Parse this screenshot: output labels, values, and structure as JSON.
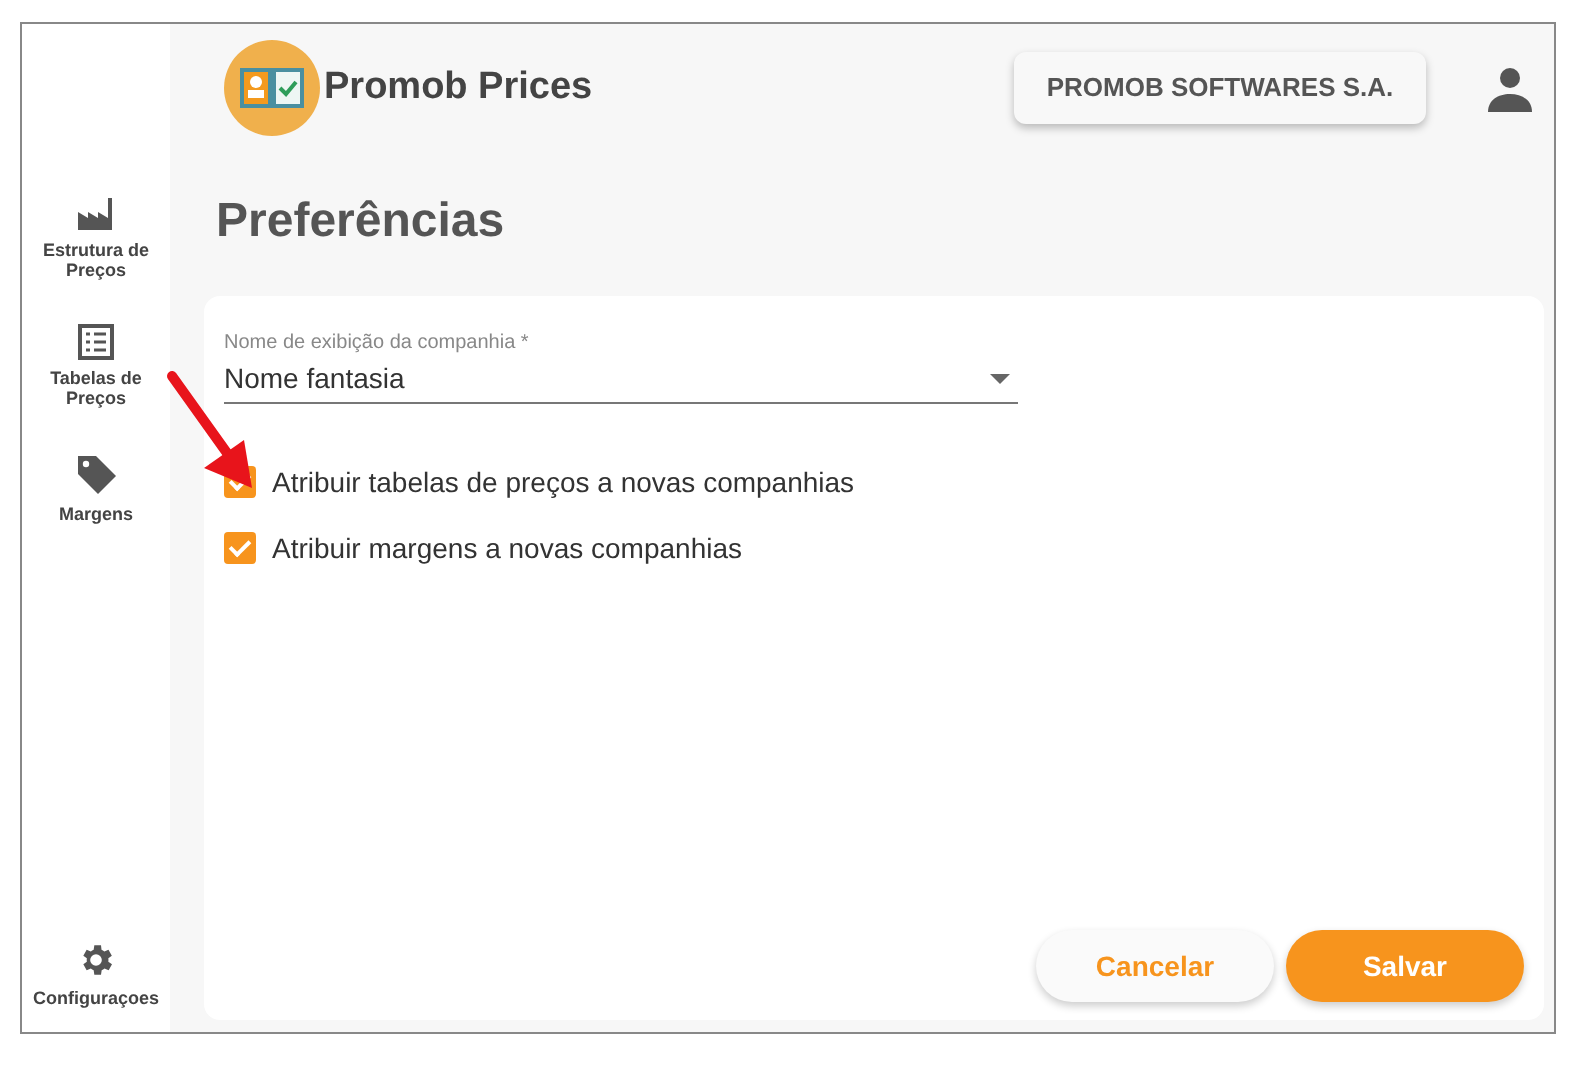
{
  "app": {
    "title": "Promob Prices",
    "company": "PROMOB SOFTWARES S.A."
  },
  "sidebar": {
    "items": [
      {
        "kind": "factory",
        "label": "Estrutura de Preços"
      },
      {
        "kind": "list",
        "label": "Tabelas de Preços"
      },
      {
        "kind": "tag",
        "label": "Margens"
      }
    ],
    "footer": {
      "kind": "gear",
      "label": "Configuraçoes"
    }
  },
  "page": {
    "title": "Preferências"
  },
  "form": {
    "select": {
      "label": "Nome de exibição da companhia *",
      "value": "Nome fantasia"
    },
    "checkboxes": [
      {
        "label": "Atribuir tabelas de preços a novas companhias",
        "checked": true
      },
      {
        "label": "Atribuir margens a novas companhias",
        "checked": true
      }
    ],
    "buttons": [
      {
        "kind": "secondary",
        "label": "Cancelar"
      },
      {
        "kind": "primary",
        "label": "Salvar"
      }
    ]
  }
}
